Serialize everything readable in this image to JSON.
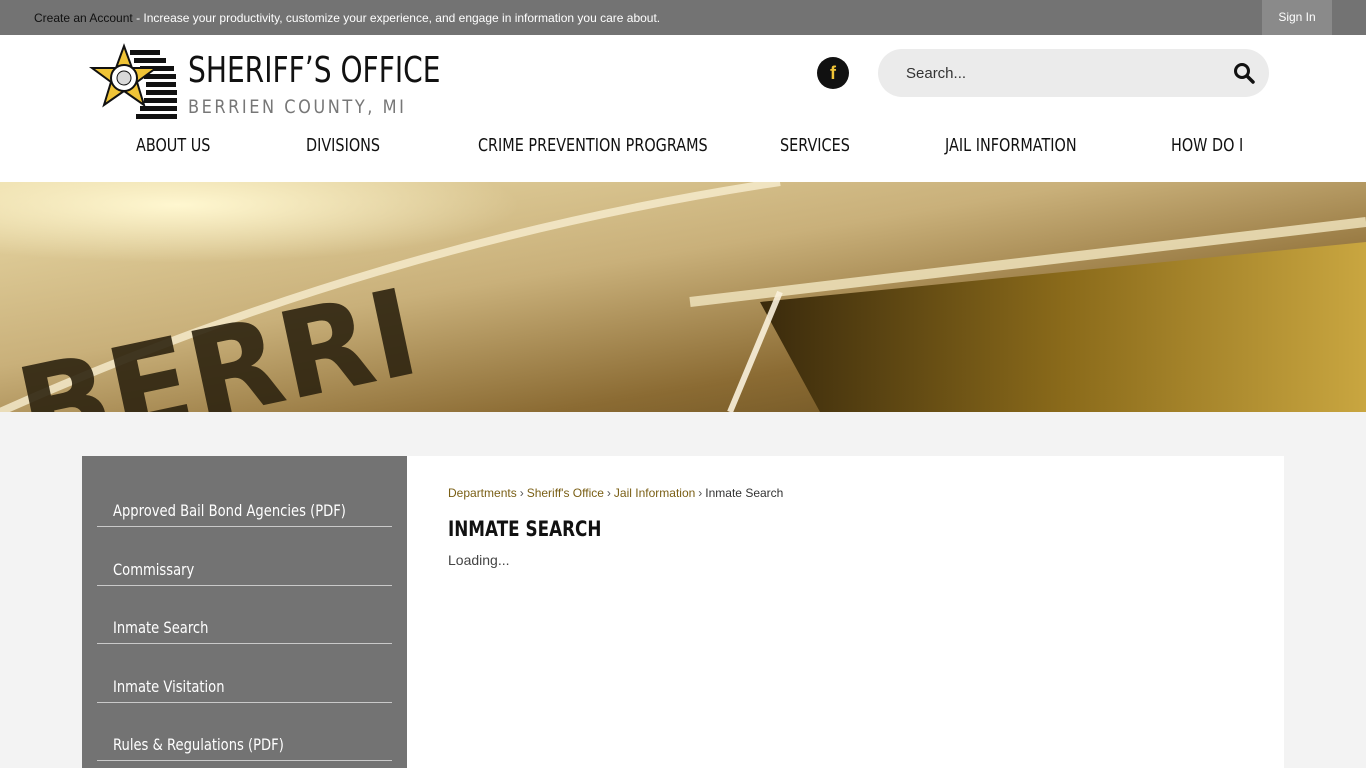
{
  "topbar": {
    "create_account": "Create an Account",
    "message": " - Increase your productivity, customize your experience, and engage in information you care about.",
    "sign_in": "Sign In"
  },
  "logo": {
    "title": "SHERIFF’S OFFICE",
    "subtitle": "BERRIEN COUNTY, MI",
    "badge_text": "BERRIEN COUNTY"
  },
  "social": {
    "facebook": "f"
  },
  "search": {
    "placeholder": "Search..."
  },
  "nav": [
    "ABOUT US",
    "DIVISIONS",
    "CRIME PREVENTION PROGRAMS",
    "SERVICES",
    "JAIL INFORMATION",
    "HOW DO I"
  ],
  "banner": {
    "badge_letters": "BERRI"
  },
  "sidebar": {
    "items": [
      "Approved Bail Bond Agencies (PDF)",
      "Commissary",
      "Inmate Search",
      "Inmate Visitation",
      "Rules & Regulations (PDF)"
    ]
  },
  "breadcrumb": {
    "links": [
      "Departments",
      "Sheriff's Office",
      "Jail Information"
    ],
    "current": "Inmate Search",
    "separator": "›"
  },
  "page": {
    "title": "INMATE SEARCH",
    "status": "Loading..."
  },
  "colors": {
    "topbar": "#737373",
    "sidebar": "#737373",
    "breadcrumb_link": "#7a5f15",
    "badge_gold": "#f0c437"
  }
}
